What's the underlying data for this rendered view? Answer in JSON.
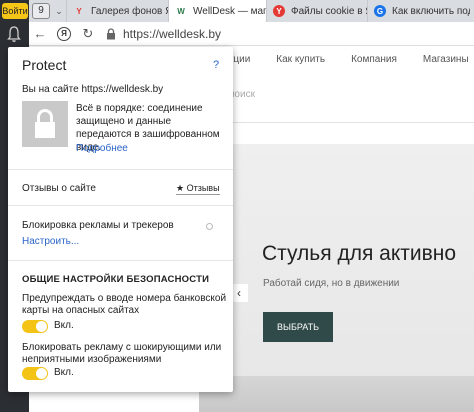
{
  "browser": {
    "login_label": "Войти",
    "tab_count": "9",
    "tabs": [
      {
        "title": "Галерея фонов Янд",
        "icon": "Y",
        "icon_color": "#e53935"
      },
      {
        "title": "WellDesk — мага",
        "icon": "W",
        "icon_color": "#2a7a4b"
      },
      {
        "title": "Файлы cookie в Янде",
        "icon": "Y",
        "icon_color": "#e53935"
      },
      {
        "title": "Как включить подд",
        "icon": "G",
        "icon_color": "#1a73e8"
      }
    ],
    "url": "https://welldesk.by"
  },
  "site": {
    "nav": [
      "кции",
      "Как купить",
      "Компания",
      "Магазины",
      "%"
    ],
    "search_hint": "поиск",
    "hero_title": "Стулья для активно",
    "hero_sub": "Работай сидя, но в движении",
    "hero_button": "ВЫБРАТЬ",
    "prev_arrow": "‹"
  },
  "protect": {
    "logo": "Protect",
    "help": "?",
    "site_line": "Вы на сайте https://welldesk.by",
    "description": "Всё в порядке: соединение защищено и данные передаются в зашифрованном виде.",
    "more_link": "Подробнее",
    "reviews_label": "Отзывы о сайте",
    "reviews_button": "★ Отзывы",
    "block_label": "Блокировка рекламы и трекеров",
    "configure_link": "Настроить...",
    "security_heading": "ОБЩИЕ НАСТРОЙКИ БЕЗОПАСНОСТИ",
    "option1": "Предупреждать о вводе номера банковской карты на опасных сайтах",
    "option1_state": "Вкл.",
    "option2": "Блокировать рекламу с шокирующими или неприятными изображениями",
    "option2_state": "Вкл."
  }
}
